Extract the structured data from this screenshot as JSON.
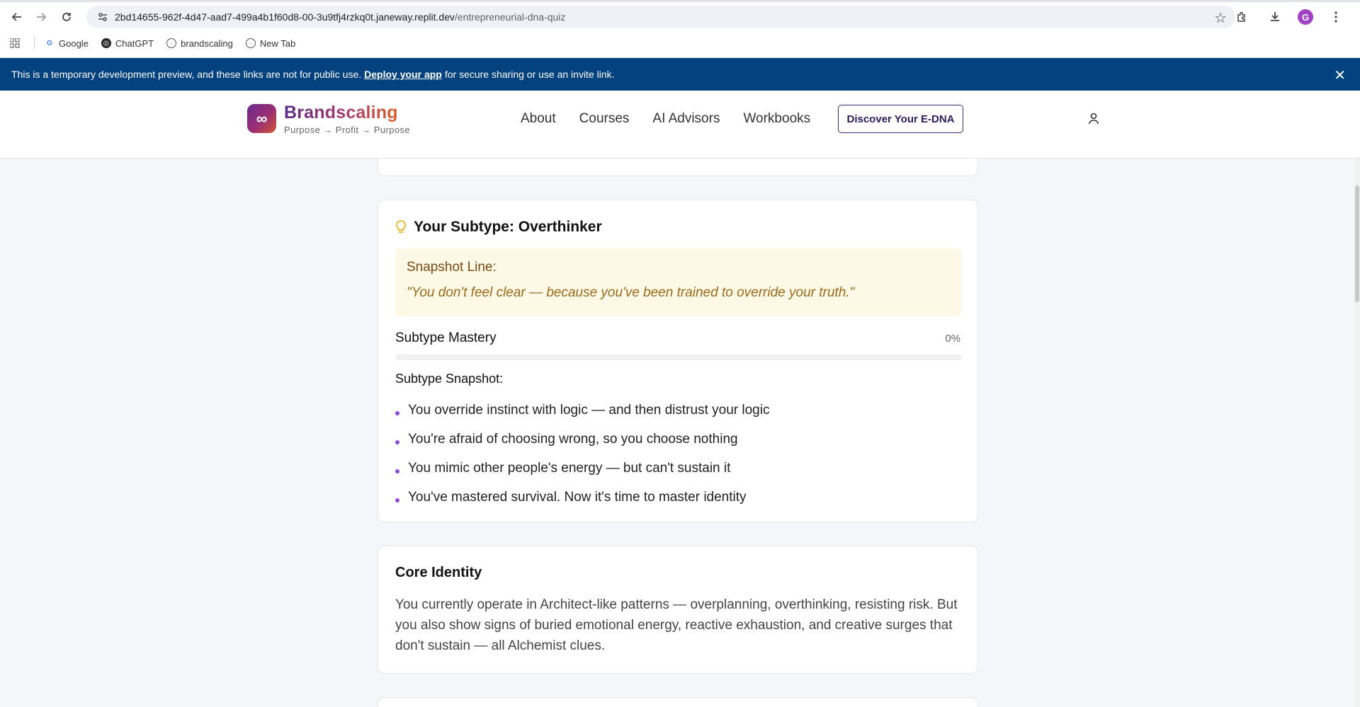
{
  "browser": {
    "url_host": "2bd14655-962f-4d47-aad7-499a4b1f60d8-00-3u9tfj4rzkq0t.janeway.replit.dev",
    "url_path": "/entrepreneurial-dna-quiz",
    "avatar_letter": "G",
    "bookmarks": [
      {
        "label": "Google",
        "icon": "google-icon"
      },
      {
        "label": "ChatGPT",
        "icon": "chatgpt-icon"
      },
      {
        "label": "brandscaling",
        "icon": "globe-icon"
      },
      {
        "label": "New Tab",
        "icon": "globe-icon"
      }
    ]
  },
  "banner": {
    "text_before": "This is a temporary development preview, and these links are not for public use.",
    "link": "Deploy your app",
    "text_after": "for secure sharing or use an invite link."
  },
  "header": {
    "brand": "Brandscaling",
    "tagline": "Purpose → Profit → Purpose",
    "logo_glyph": "∞",
    "nav": [
      "About",
      "Courses",
      "AI Advisors",
      "Workbooks"
    ],
    "cta": "Discover Your E-DNA"
  },
  "subtype": {
    "title": "Your Subtype: Overthinker",
    "snapshot_label": "Snapshot Line:",
    "snapshot_quote": "\"You don't feel clear — because you've been trained to override your truth.\"",
    "mastery_label": "Subtype Mastery",
    "mastery_value": "0%",
    "mastery_fraction": 0,
    "snapshot_heading": "Subtype Snapshot:",
    "bullets": [
      "You override instinct with logic — and then distrust your logic",
      "You're afraid of choosing wrong, so you choose nothing",
      "You mimic other people's energy — but can't sustain it",
      "You've mastered survival. Now it's time to master identity"
    ]
  },
  "core": {
    "title": "Core Identity",
    "text": "You currently operate in Architect-like patterns — overplanning, overthinking, resisting risk. But you also show signs of buried emotional energy, reactive exhaustion, and creative surges that don't sustain — all Alchemist clues."
  },
  "colors": {
    "banner": "#03427f",
    "accent_purple": "#8a4bd6",
    "snapshot_bg": "#fef9e7",
    "snapshot_text": "#9a6a18"
  }
}
